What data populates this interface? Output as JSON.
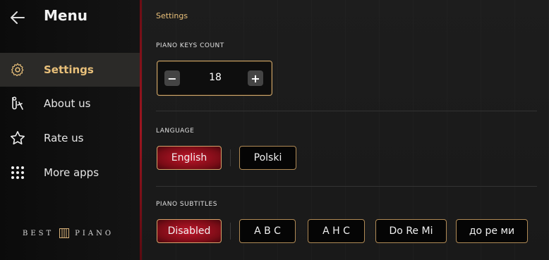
{
  "sidebar": {
    "title": "Menu",
    "items": [
      {
        "label": "Settings",
        "icon": "gear-icon",
        "active": true
      },
      {
        "label": "About us",
        "icon": "about-icon",
        "active": false
      },
      {
        "label": "Rate us",
        "icon": "star-icon",
        "active": false
      },
      {
        "label": "More apps",
        "icon": "grid-icon",
        "active": false
      }
    ],
    "brand": {
      "left": "BEST",
      "right": "PIANO"
    }
  },
  "main": {
    "breadcrumb": "Settings",
    "keys_count": {
      "label": "PIANO KEYS COUNT",
      "value": "18",
      "minus": "−",
      "plus": "+"
    },
    "language": {
      "label": "LANGUAGE",
      "options": [
        "English",
        "Polski"
      ],
      "selected": "English"
    },
    "subtitles": {
      "label": "PIANO SUBTITLES",
      "options": [
        "Disabled",
        "A B C",
        "A H C",
        "Do Re Mi",
        "до ре ми"
      ],
      "selected": "Disabled"
    }
  },
  "colors": {
    "accent_gold": "#e9c07a",
    "accent_red": "#c0162a",
    "border_gold": "#b08a55"
  }
}
